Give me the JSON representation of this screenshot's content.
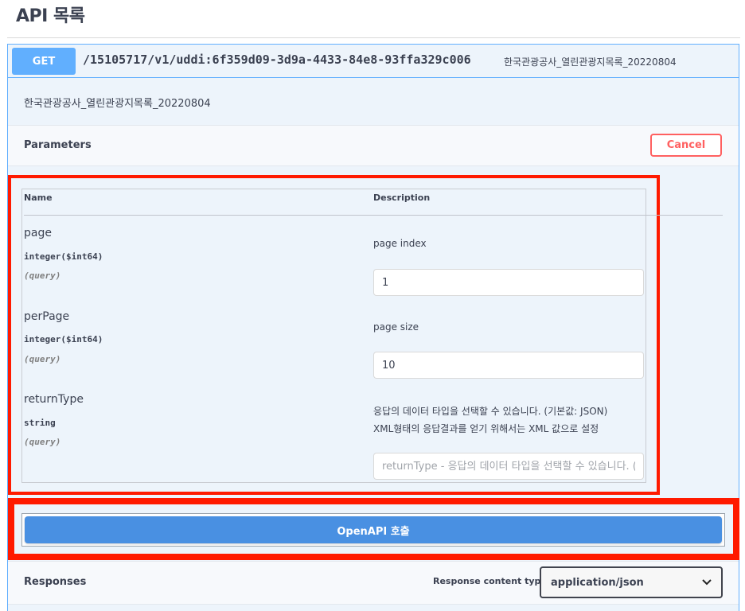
{
  "header": {
    "title": "API 목록"
  },
  "operation": {
    "method": "GET",
    "path": "/15105717/v1/uddi:6f359d09-3d9a-4433-84e8-93ffa329c006",
    "summary": "한국관광공사_열린관광지목록_20220804",
    "description": "한국관광공사_열린관광지목록_20220804"
  },
  "parameters_section": {
    "title": "Parameters",
    "cancel_label": "Cancel",
    "columns": {
      "name": "Name",
      "description": "Description"
    },
    "params": [
      {
        "name": "page",
        "type": "integer($int64)",
        "in": "(query)",
        "description": "page index",
        "value": "1",
        "placeholder": ""
      },
      {
        "name": "perPage",
        "type": "integer($int64)",
        "in": "(query)",
        "description": "page size",
        "value": "10",
        "placeholder": ""
      },
      {
        "name": "returnType",
        "type": "string",
        "in": "(query)",
        "description_line1": "응답의 데이터 타입을 선택할 수 있습니다. (기본값: JSON)",
        "description_line2": "XML형태의 응답결과를 얻기 위해서는 XML 값으로 설정",
        "value": "",
        "placeholder": "returnType - 응답의 데이터 타입을 선택할 수 있습니다. (기본값: JSON)"
      }
    ]
  },
  "execute": {
    "label": "OpenAPI 호출"
  },
  "responses_section": {
    "title": "Responses",
    "content_type_label": "Response content type",
    "content_type_value": "application/json"
  },
  "colors": {
    "get_accent": "#61affe",
    "execute_blue": "#4990e2",
    "cancel_red": "#ff6060",
    "highlight_red": "#ff1a00",
    "block_bg": "#edf4fb"
  },
  "icons": {
    "select_arrow": "chevron-down-icon"
  }
}
